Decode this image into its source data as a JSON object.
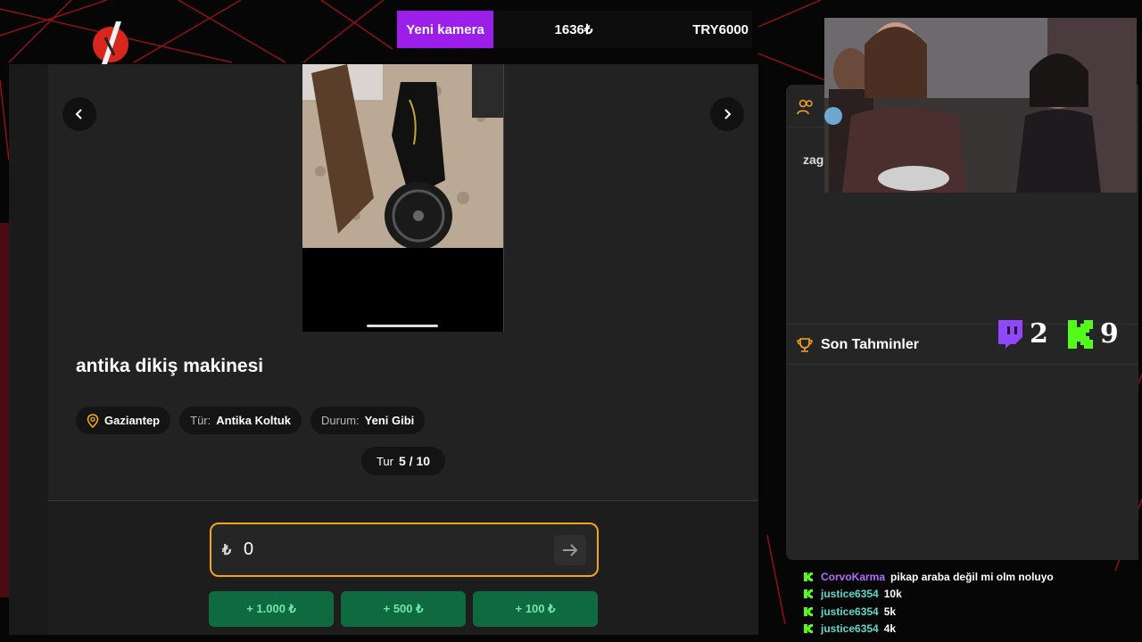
{
  "ticker": {
    "tag": "Yeni kamera",
    "current": "1636₺",
    "goal": "TRY6000"
  },
  "listing": {
    "title": "antika dikiş makinesi",
    "location": "Gaziantep",
    "type_label": "Tür:",
    "type_value": "Antika Koltuk",
    "condition_label": "Durum:",
    "condition_value": "Yeni Gibi"
  },
  "round": {
    "label": "Tur",
    "value": "5 / 10"
  },
  "guess": {
    "currency": "₺",
    "value": "0"
  },
  "quick_buttons": [
    {
      "label": "+ 1.000 ₺"
    },
    {
      "label": "+ 500 ₺"
    },
    {
      "label": "+ 100 ₺"
    }
  ],
  "right_panel": {
    "user_partial": "zag",
    "section_title": "Son Tahminler",
    "twitch_count": "2",
    "kick_count": "9"
  },
  "chat": [
    {
      "user": "CorvoKarma",
      "color": "#b36bff",
      "message": "pikap araba değil mi olm noluyo"
    },
    {
      "user": "justice6354",
      "color": "#5fd9c9",
      "message": "10k"
    },
    {
      "user": "justice6354",
      "color": "#5fd9c9",
      "message": "5k"
    },
    {
      "user": "justice6354",
      "color": "#5fd9c9",
      "message": "4k"
    }
  ],
  "colors": {
    "accent": "#f4a51c",
    "quick_bg": "#106a40",
    "tag_bg": "#9b1fe8",
    "kick": "#53fc18",
    "twitch": "#9146ff"
  }
}
